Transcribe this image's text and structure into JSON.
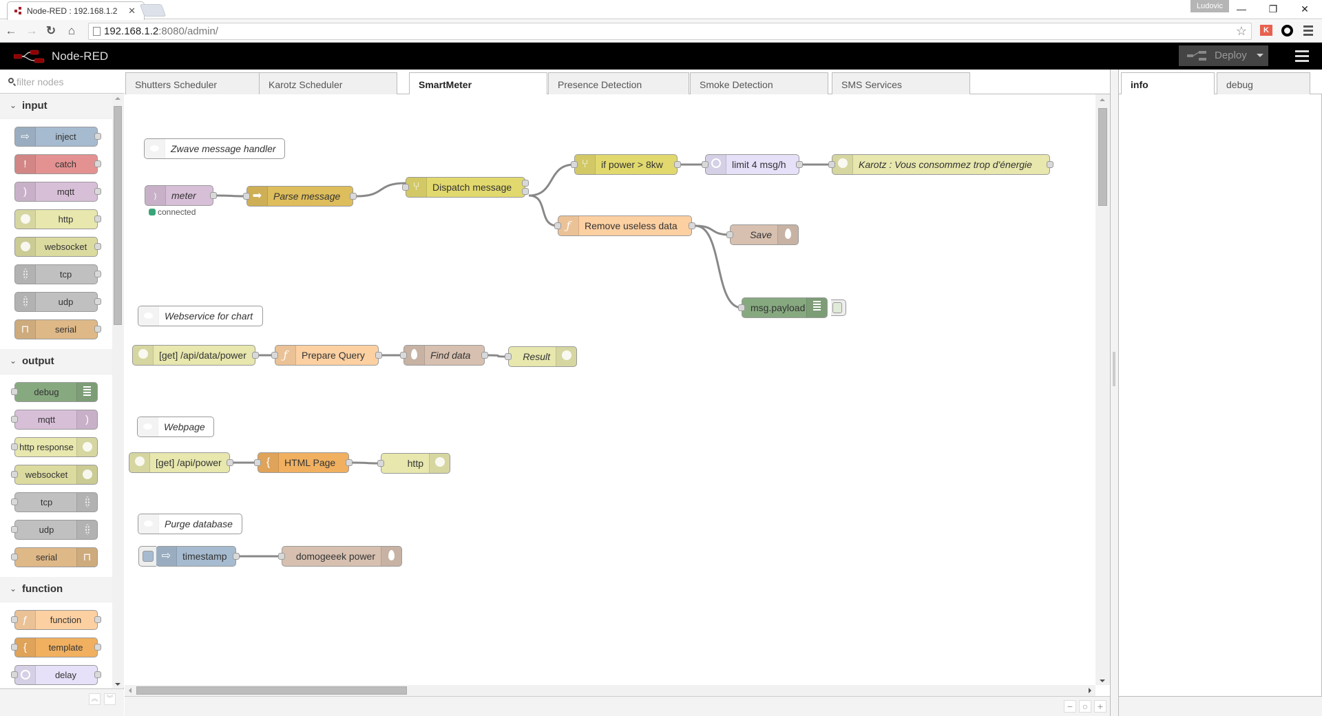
{
  "browser": {
    "tab_title": "Node-RED : 192.168.1.2",
    "user": "Ludovic",
    "url_host": "192.168.1.2",
    "url_rest": ":8080/admin/"
  },
  "header": {
    "title": "Node-RED",
    "deploy_label": "Deploy"
  },
  "palette": {
    "filter_placeholder": "filter nodes",
    "sections": [
      {
        "label": "input",
        "nodes": [
          {
            "label": "inject",
            "color": "#a6bbcf",
            "icon": "arrow-in-icon",
            "glyph": "⇨"
          },
          {
            "label": "catch",
            "color": "#e49191",
            "icon": "exclamation-icon",
            "glyph": "!"
          },
          {
            "label": "mqtt",
            "color": "#d8bfd8",
            "icon": "bridge-icon",
            "glyph": ")"
          },
          {
            "label": "http",
            "color": "#e7e7ae",
            "icon": "globe-icon",
            "glyph": ""
          },
          {
            "label": "websocket",
            "color": "#dbdba0",
            "icon": "globe-icon",
            "glyph": ""
          },
          {
            "label": "tcp",
            "color": "#c0c0c0",
            "icon": "bridge-dots-icon",
            "glyph": ""
          },
          {
            "label": "udp",
            "color": "#c0c0c0",
            "icon": "bridge-dots-icon",
            "glyph": ""
          },
          {
            "label": "serial",
            "color": "#deb887",
            "icon": "serial-icon",
            "glyph": "⊓"
          }
        ]
      },
      {
        "label": "output",
        "nodes": [
          {
            "label": "debug",
            "color": "#87a980",
            "icon": "debug-icon"
          },
          {
            "label": "mqtt",
            "color": "#d8bfd8",
            "icon": "bridge-icon",
            "glyph": ")"
          },
          {
            "label": "http response",
            "color": "#e7e7ae",
            "icon": "globe-icon"
          },
          {
            "label": "websocket",
            "color": "#dbdba0",
            "icon": "globe-icon"
          },
          {
            "label": "tcp",
            "color": "#c0c0c0",
            "icon": "bridge-dots-icon"
          },
          {
            "label": "udp",
            "color": "#c0c0c0",
            "icon": "bridge-dots-icon"
          },
          {
            "label": "serial",
            "color": "#deb887",
            "icon": "serial-icon",
            "glyph": "⊓"
          }
        ]
      },
      {
        "label": "function",
        "nodes": [
          {
            "label": "function",
            "color": "#fdd0a2",
            "icon": "function-icon",
            "glyph": "ƒ"
          },
          {
            "label": "template",
            "color": "#f0b060",
            "icon": "template-icon",
            "glyph": "{"
          },
          {
            "label": "delay",
            "color": "#e6e0f8",
            "icon": "timer-icon"
          }
        ]
      }
    ]
  },
  "workspace": {
    "tabs": [
      {
        "label": "Shutters Scheduler",
        "active": false
      },
      {
        "label": "Karotz Scheduler",
        "active": false
      },
      {
        "label": "SmartMeter",
        "active": true
      },
      {
        "label": "Presence Detection",
        "active": false
      },
      {
        "label": "Smoke Detection",
        "active": false
      },
      {
        "label": "SMS Services",
        "active": false
      }
    ],
    "add_tab_label": "+",
    "comments": [
      {
        "id": "c1",
        "label": "Zwave message handler"
      },
      {
        "id": "c2",
        "label": "Webservice for chart"
      },
      {
        "id": "c3",
        "label": "Webpage"
      },
      {
        "id": "c4",
        "label": "Purge database"
      }
    ],
    "nodes": {
      "meter": {
        "label": "meter",
        "type": "mqtt in",
        "color": "#d8bfd8",
        "status": "connected"
      },
      "parse": {
        "label": "Parse message",
        "type": "json",
        "color": "#debd5c"
      },
      "dispatch": {
        "label": "Dispatch message",
        "type": "switch",
        "color": "#e2d96e"
      },
      "ifpower": {
        "label": "if power > 8kw",
        "type": "switch",
        "color": "#e2d96e"
      },
      "limit": {
        "label": "limit 4 msg/h",
        "type": "delay",
        "color": "#e6e0f8"
      },
      "karotz": {
        "label": "Karotz : Vous consommez trop d'énergie",
        "type": "http request",
        "color": "#e7e7ae"
      },
      "remove": {
        "label": "Remove useless data",
        "type": "function",
        "color": "#fdd0a2"
      },
      "save": {
        "label": "Save",
        "type": "mongodb out",
        "color": "#d7c0b0"
      },
      "msgpayload": {
        "label": "msg.payload",
        "type": "debug",
        "color": "#87a980"
      },
      "getdata": {
        "label": "[get] /api/data/power",
        "type": "http in",
        "color": "#e7e7ae"
      },
      "prepare": {
        "label": "Prepare Query",
        "type": "function",
        "color": "#fdd0a2"
      },
      "find": {
        "label": "Find data",
        "type": "mongodb in",
        "color": "#d7c0b0"
      },
      "result": {
        "label": "Result",
        "type": "http response",
        "color": "#e7e7ae"
      },
      "getpower": {
        "label": "[get] /api/power",
        "type": "http in",
        "color": "#e7e7ae"
      },
      "htmlpage": {
        "label": "HTML Page",
        "type": "template",
        "color": "#f0b060"
      },
      "http": {
        "label": "http",
        "type": "http response",
        "color": "#e7e7ae"
      },
      "timestamp": {
        "label": "timestamp",
        "type": "inject",
        "color": "#a6bbcf"
      },
      "domogeeek": {
        "label": "domogeeek power",
        "type": "mongodb out",
        "color": "#d7c0b0"
      }
    }
  },
  "sidebar": {
    "tabs": [
      {
        "label": "info",
        "active": true
      },
      {
        "label": "debug",
        "active": false
      }
    ]
  }
}
